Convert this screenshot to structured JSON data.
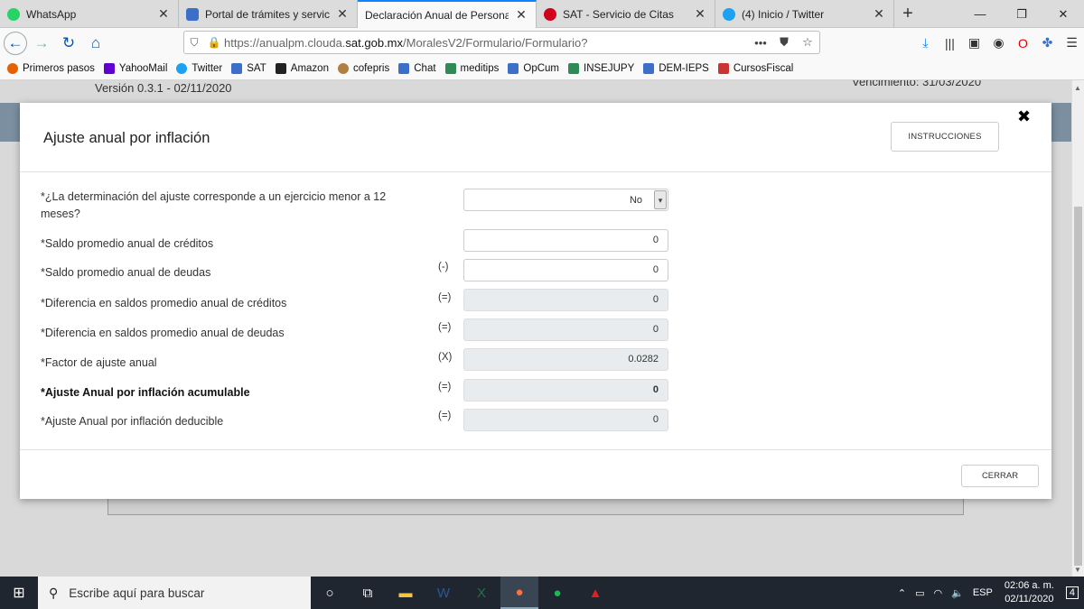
{
  "browser": {
    "tabs": [
      {
        "label": "WhatsApp",
        "color": "#25d366",
        "active": false
      },
      {
        "label": "Portal de trámites y servicios - S",
        "color": "#3b6fc9",
        "active": false
      },
      {
        "label": "Declaración Anual de Personas Mo",
        "color": "#ffffff",
        "active": true
      },
      {
        "label": "SAT - Servicio de Citas",
        "color": "#d0021b",
        "active": false
      },
      {
        "label": "(4) Inicio / Twitter",
        "color": "#1da1f2",
        "active": false
      }
    ],
    "url_prefix": "https://anualpm.clouda.",
    "url_domain": "sat.gob.mx",
    "url_suffix": "/MoralesV2/Formulario/Formulario?",
    "bookmarks": [
      {
        "label": "Primeros pasos",
        "color": "#e66000"
      },
      {
        "label": "YahooMail",
        "color": "#6001d2"
      },
      {
        "label": "Twitter",
        "color": "#1da1f2"
      },
      {
        "label": "SAT",
        "color": "#3b6fc9"
      },
      {
        "label": "Amazon",
        "color": "#222222"
      },
      {
        "label": "cofepris",
        "color": "#b08040"
      },
      {
        "label": "Chat",
        "color": "#3b6fc9"
      },
      {
        "label": "meditips",
        "color": "#2e8b57"
      },
      {
        "label": "OpCum",
        "color": "#3b6fc9"
      },
      {
        "label": "INSEJUPY",
        "color": "#2e8b57"
      },
      {
        "label": "DEM-IEPS",
        "color": "#3b6fc9"
      },
      {
        "label": "CursosFiscal",
        "color": "#cc3333"
      }
    ]
  },
  "page": {
    "version": "Versión 0.3.1 - 02/11/2020",
    "vencimiento": "Vencimiento: 31/03/2020"
  },
  "modal": {
    "title": "Ajuste anual por inflación",
    "instructions_label": "INSTRUCCIONES",
    "close_glyph": "✖",
    "close_label": "CERRAR",
    "question": {
      "label": "*¿La determinación del ajuste corresponde a un ejercicio menor a 12 meses?",
      "value": "No"
    },
    "rows": [
      {
        "label": "*Saldo promedio anual de créditos",
        "op": "",
        "value": "0",
        "readonly": false,
        "bold": false
      },
      {
        "label": "*Saldo promedio anual de deudas",
        "op": "(-)",
        "value": "0",
        "readonly": false,
        "bold": false
      },
      {
        "label": "*Diferencia en saldos promedio anual de créditos",
        "op": "(=)",
        "value": "0",
        "readonly": true,
        "bold": false
      },
      {
        "label": "*Diferencia en saldos promedio anual de deudas",
        "op": "(=)",
        "value": "0",
        "readonly": true,
        "bold": false
      },
      {
        "label": "*Factor de ajuste anual",
        "op": "(X)",
        "value": "0.0282",
        "readonly": true,
        "bold": false
      },
      {
        "label": "*Ajuste Anual por inflación acumulable",
        "op": "(=)",
        "value": "0",
        "readonly": true,
        "bold": true
      },
      {
        "label": "*Ajuste Anual por inflación deducible",
        "op": "(=)",
        "value": "0",
        "readonly": true,
        "bold": false
      }
    ]
  },
  "taskbar": {
    "search_placeholder": "Escribe aquí para buscar",
    "lang": "ESP",
    "time": "02:06 a. m.",
    "date": "02/11/2020",
    "notifications": "4"
  }
}
